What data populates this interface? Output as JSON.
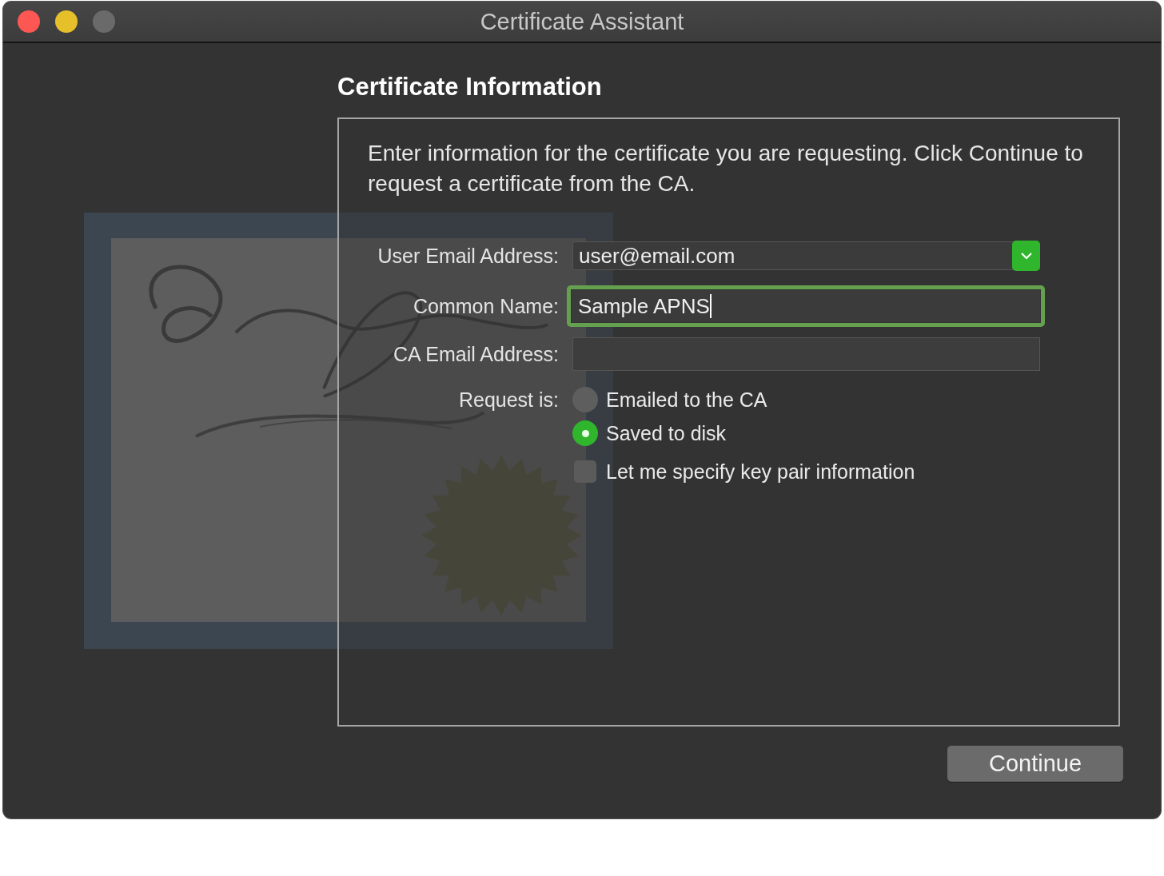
{
  "window": {
    "title": "Certificate Assistant"
  },
  "heading": "Certificate Information",
  "description": "Enter information for the certificate you are requesting. Click Continue to request a certificate from the CA.",
  "fields": [
    {
      "kind": "combo",
      "label": "User Email Address:",
      "value": "user@email.com",
      "focused": false
    },
    {
      "kind": "text",
      "label": "Common Name:",
      "value": "Sample APNS",
      "focused": true
    },
    {
      "kind": "text",
      "label": "CA Email Address:",
      "focused": false
    }
  ],
  "request": {
    "label": "Request is:",
    "options": [
      {
        "label": "Emailed to the CA",
        "selected": false
      },
      {
        "label": "Saved to disk",
        "selected": true
      }
    ]
  },
  "key_pair_checkbox": {
    "label": "Let me specify key pair information",
    "checked": false
  },
  "continue_button": "Continue"
}
